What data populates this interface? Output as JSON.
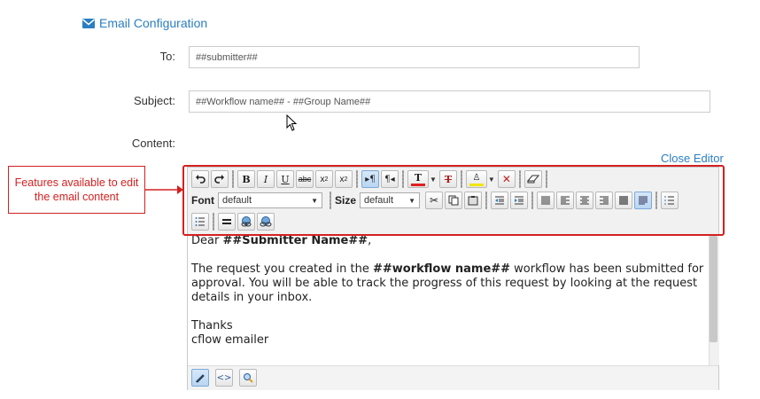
{
  "section": {
    "title": "Email Configuration",
    "icon": "envelope-icon"
  },
  "fields": {
    "to": {
      "label": "To:",
      "value": "##submitter##"
    },
    "subject": {
      "label": "Subject:",
      "value": "##Workflow name## - ##Group Name##"
    },
    "content": {
      "label": "Content:"
    }
  },
  "close_editor": "Close Editor",
  "toolbar": {
    "font_label": "Font",
    "font_value": "default",
    "size_label": "Size",
    "size_value": "default"
  },
  "editor_text": {
    "greeting_prefix": "Dear ",
    "greeting_bold": "##Submitter Name##",
    "greeting_suffix": ",",
    "para_prefix": "The request you created in the ",
    "para_bold": "##workflow name##",
    "para_suffix": " workflow has been submitted for approval. You will be able to track the progress of this request by looking at the request details in your inbox.",
    "thanks": "Thanks",
    "signature": "cflow emailer"
  },
  "annotation": {
    "text": "Features available to edit the email content",
    "color": "#d42020"
  },
  "colors": {
    "accent": "#2b7ec1",
    "highlight": "#d42020",
    "text_color_bar": "#e02020",
    "bg_color_bar": "#f2e600"
  }
}
